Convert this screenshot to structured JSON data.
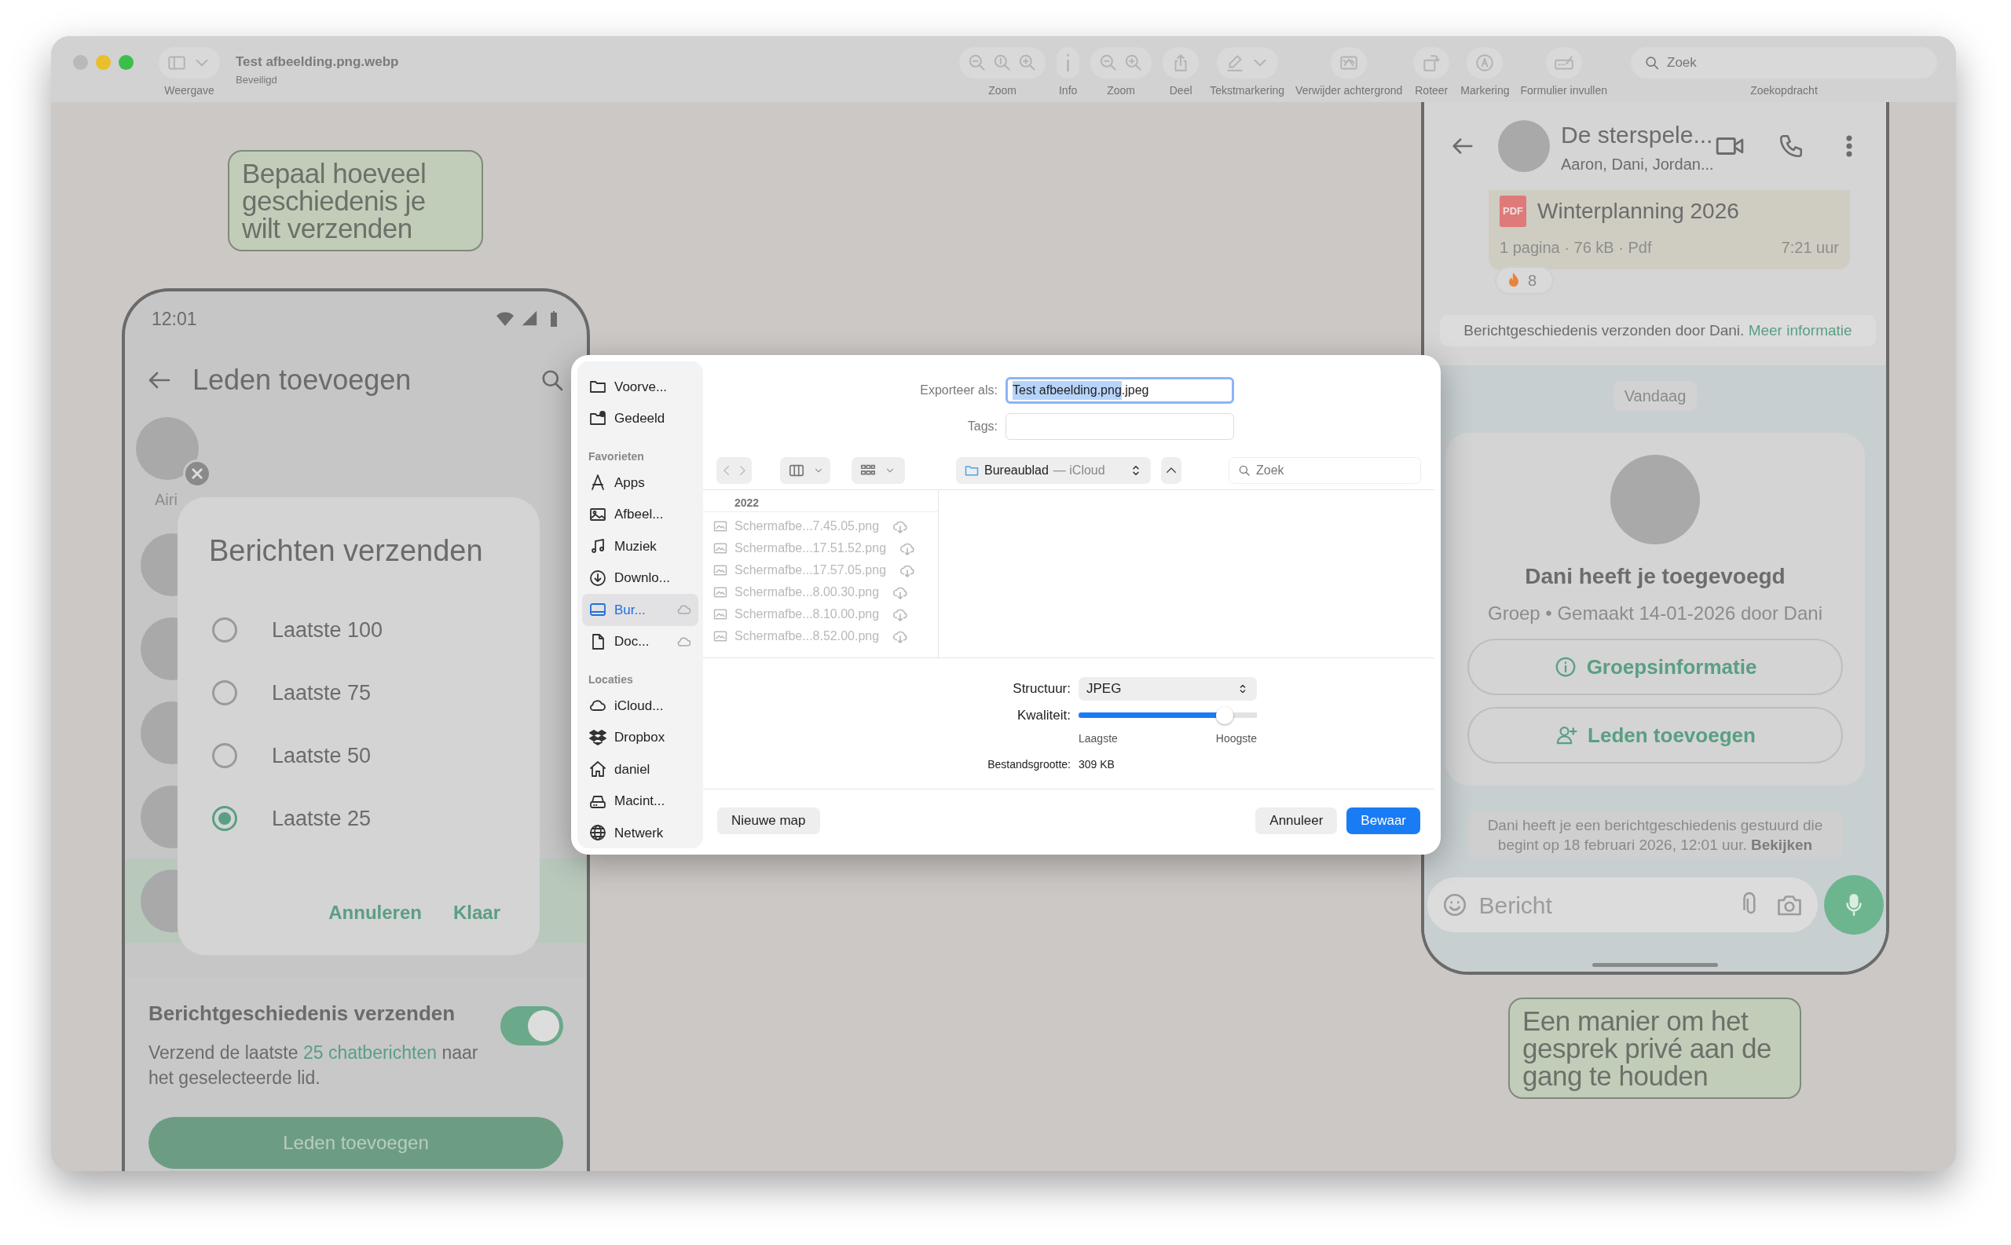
{
  "window": {
    "title": "Test afbeelding.png.webp",
    "subtitle": "Beveiligd"
  },
  "toolbar": [
    {
      "kind": "sidebar",
      "label": "Weergave"
    },
    {
      "kind": "zoom3",
      "label": "Zoom"
    },
    {
      "kind": "info",
      "label": "Info"
    },
    {
      "kind": "zoom2",
      "label": "Zoom"
    },
    {
      "kind": "share",
      "label": "Deel"
    },
    {
      "kind": "highlight",
      "label": "Tekstmarkering"
    },
    {
      "kind": "removebg",
      "label": "Verwijder achtergrond"
    },
    {
      "kind": "rotate",
      "label": "Roteer"
    },
    {
      "kind": "markup",
      "label": "Markering"
    },
    {
      "kind": "form",
      "label": "Formulier invullen"
    }
  ],
  "toolbar_search": {
    "placeholder": "Zoek",
    "label": "Zoekopdracht"
  },
  "left_caption": "Bepaal hoeveel geschiedenis je wilt verzenden",
  "left_phone": {
    "time": "12:01",
    "title": "Leden toevoegen",
    "selected_contact": "Airi",
    "contacts": [
      {
        "selected": false
      },
      {
        "selected": false
      },
      {
        "selected": false
      },
      {
        "selected": false
      },
      {
        "selected": true
      }
    ],
    "dialog": {
      "title": "Berichten verzenden",
      "options": [
        {
          "label": "Laatste 100",
          "selected": false
        },
        {
          "label": "Laatste 75",
          "selected": false
        },
        {
          "label": "Laatste 50",
          "selected": false
        },
        {
          "label": "Laatste 25",
          "selected": true
        }
      ],
      "cancel": "Annuleren",
      "confirm": "Klaar"
    },
    "history": {
      "title": "Berichtgeschiedenis verzenden",
      "text_before": "Verzend de laatste",
      "link": "25 chatberichten",
      "text_after": "naar het geselecteerde lid.",
      "on": true
    },
    "button": "Leden toevoegen"
  },
  "export_dialog": {
    "sidebar": [
      {
        "kind": "folder",
        "label": "Voorve...",
        "selected": false,
        "cloud": false
      },
      {
        "kind": "shared",
        "label": "Gedeeld",
        "selected": false,
        "cloud": false
      },
      {
        "kind": "header",
        "label": "Favorieten"
      },
      {
        "kind": "apps",
        "label": "Apps",
        "selected": false,
        "cloud": false
      },
      {
        "kind": "image",
        "label": "Afbeel...",
        "selected": false,
        "cloud": false
      },
      {
        "kind": "music",
        "label": "Muziek",
        "selected": false,
        "cloud": false
      },
      {
        "kind": "download",
        "label": "Downlo...",
        "selected": false,
        "cloud": false
      },
      {
        "kind": "desktop",
        "label": "Bur...",
        "selected": true,
        "cloud": true
      },
      {
        "kind": "document",
        "label": "Doc...",
        "selected": false,
        "cloud": true
      },
      {
        "kind": "header",
        "label": "Locaties"
      },
      {
        "kind": "cloud",
        "label": "iCloud...",
        "selected": false,
        "cloud": false
      },
      {
        "kind": "dropbox",
        "label": "Dropbox",
        "selected": false,
        "cloud": false
      },
      {
        "kind": "home",
        "label": "daniel",
        "selected": false,
        "cloud": false
      },
      {
        "kind": "drive",
        "label": "Macint...",
        "selected": false,
        "cloud": false
      },
      {
        "kind": "globe",
        "label": "Netwerk",
        "selected": false,
        "cloud": false
      }
    ],
    "export_label": "Exporteer als:",
    "export_selected": "Test afbeelding.png",
    "export_rest": ".jpeg",
    "tags_label": "Tags:",
    "location": "Bureaublad",
    "location_detail": "— iCloud",
    "search": {
      "placeholder": "Zoek"
    },
    "group": "2022",
    "files": [
      {
        "name": "Schermafbe...7.45.05.png",
        "disabled": true
      },
      {
        "name": "Schermafbe...17.51.52.png",
        "disabled": true
      },
      {
        "name": "Schermafbe...17.57.05.png",
        "disabled": true
      },
      {
        "name": "Schermafbe...8.00.30.png",
        "disabled": true
      },
      {
        "name": "Schermafbe...8.10.00.png",
        "disabled": true
      },
      {
        "name": "Schermafbe...8.52.00.png",
        "disabled": true
      }
    ],
    "format_label": "Structuur:",
    "format": "JPEG",
    "quality_label": "Kwaliteit:",
    "quality": {
      "level": 0.82
    },
    "quality_min": "Laagste",
    "quality_max": "Hoogste",
    "size_label": "Bestandsgrootte:",
    "size": "309 KB",
    "new_folder": "Nieuwe map",
    "cancel": "Annuleer",
    "save": "Bewaar"
  },
  "right_phone": {
    "group_name": "De sterspele...",
    "members": "Aaron, Dani, Jordan...",
    "document": {
      "badge": "PDF",
      "title": "Winterplanning 2026",
      "meta": "1 pagina · 76 kB · Pdf",
      "time": "7:21 uur"
    },
    "reaction_count": "8",
    "notice": {
      "text": "Berichtgeschiedenis verzonden door Dani.",
      "link": "Meer informatie"
    },
    "date_chip": "Vandaag",
    "card": {
      "title": "Dani heeft je toegevoegd",
      "subtitle": "Groep • Gemaakt 14-01-2026 door Dani",
      "buttons": [
        {
          "kind": "info",
          "label": "Groepsinformatie"
        },
        {
          "kind": "add-person",
          "label": "Leden toevoegen"
        }
      ]
    },
    "history_notice": {
      "text": "Dani heeft je een berichtgeschiedenis gestuurd die begint op 18 februari 2026, 12:01 uur.",
      "link": "Bekijken"
    },
    "composer": {
      "placeholder": "Bericht"
    }
  },
  "right_caption": "Een manier om het gesprek privé aan de gang te houden"
}
